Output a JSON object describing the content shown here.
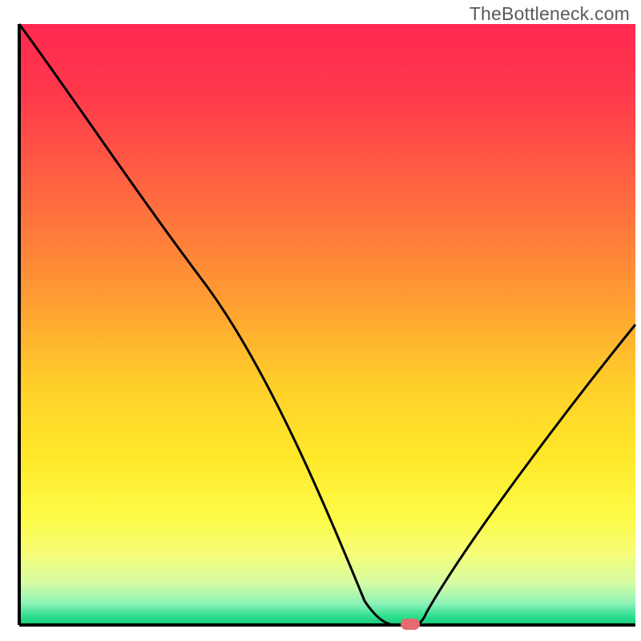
{
  "watermark": {
    "text": "TheBottleneck.com"
  },
  "chart_data": {
    "type": "line",
    "title": "",
    "xlabel": "",
    "ylabel": "",
    "xlim": [
      0,
      100
    ],
    "ylim": [
      0,
      100
    ],
    "x": [
      0,
      30,
      56,
      61,
      64,
      66,
      100
    ],
    "values": [
      100,
      57,
      4,
      0,
      0,
      2,
      50
    ],
    "series": [
      {
        "name": "bottleneck-curve",
        "x": [
          0,
          30,
          56,
          61,
          64,
          66,
          100
        ],
        "values": [
          100,
          57,
          4,
          0,
          0,
          2,
          50
        ]
      }
    ],
    "annotations": [
      {
        "name": "optimal-marker",
        "x": 63.5,
        "y": 0.3,
        "color": "#e46b6f",
        "shape": "pill"
      }
    ],
    "gradient_stops": [
      {
        "offset": 0.0,
        "color": "#ff2850"
      },
      {
        "offset": 0.12,
        "color": "#ff3a4c"
      },
      {
        "offset": 0.3,
        "color": "#ff6c3f"
      },
      {
        "offset": 0.45,
        "color": "#ff9a33"
      },
      {
        "offset": 0.6,
        "color": "#ffcf2a"
      },
      {
        "offset": 0.72,
        "color": "#ffe82a"
      },
      {
        "offset": 0.82,
        "color": "#fdfb46"
      },
      {
        "offset": 0.88,
        "color": "#f7fd75"
      },
      {
        "offset": 0.93,
        "color": "#d6fca4"
      },
      {
        "offset": 0.965,
        "color": "#8bf2b8"
      },
      {
        "offset": 0.985,
        "color": "#2fe091"
      },
      {
        "offset": 1.0,
        "color": "#18c977"
      }
    ]
  }
}
